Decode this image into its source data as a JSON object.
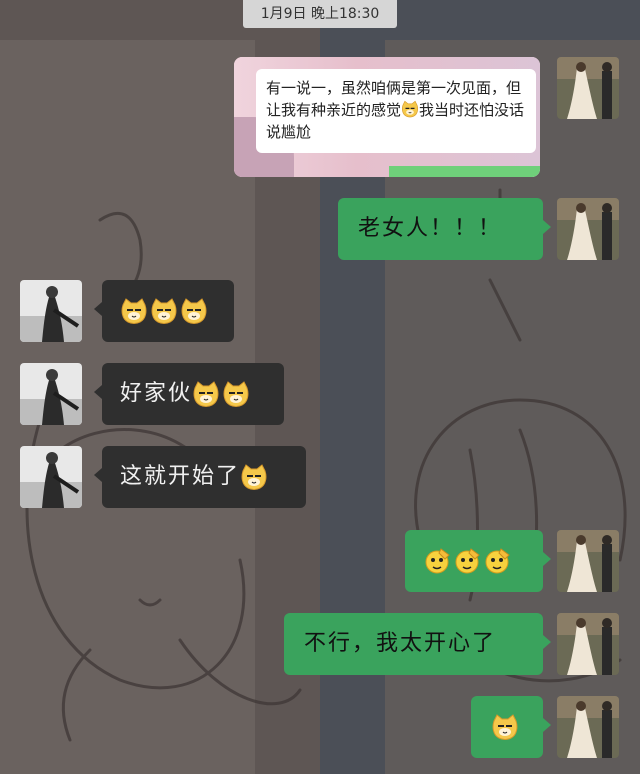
{
  "timestamp": "1月9日 晚上18:30",
  "messages": [
    {
      "side": "right",
      "type": "quote",
      "text_before": "有一说一，虽然咱俩是第一次见面，但让我有种亲近的感觉",
      "emoji_inline": "cat-smug-emoji",
      "text_after": "我当时还怕没话说尴尬"
    },
    {
      "side": "right",
      "text": "老女人！！！"
    },
    {
      "side": "left",
      "emojis": [
        "cat-smug-emoji",
        "cat-smug-emoji",
        "cat-smug-emoji"
      ]
    },
    {
      "side": "left",
      "text": "好家伙",
      "emojis": [
        "cat-smug-emoji",
        "cat-smug-emoji"
      ]
    },
    {
      "side": "left",
      "text": "这就开始了",
      "emojis": [
        "cat-smug-emoji"
      ]
    },
    {
      "side": "right",
      "emojis": [
        "salute-face-emoji",
        "salute-face-emoji",
        "salute-face-emoji"
      ]
    },
    {
      "side": "right",
      "text": "不行，我太开心了"
    },
    {
      "side": "right",
      "emojis": [
        "cat-smug-emoji"
      ]
    }
  ],
  "colors": {
    "outgoing_bubble": "#3aa35d",
    "incoming_bubble": "#2f2f2f",
    "timestamp_bg": "#d6d6d6"
  }
}
